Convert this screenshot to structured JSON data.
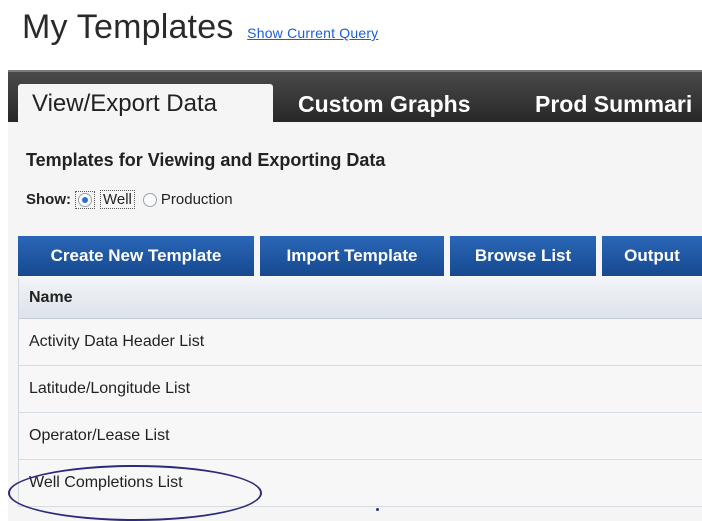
{
  "page": {
    "title": "My Templates",
    "query_link": "Show Current Query"
  },
  "tabs": [
    {
      "label": "View/Export Data",
      "active": true
    },
    {
      "label": "Custom Graphs",
      "active": false
    },
    {
      "label": "Prod Summari",
      "active": false
    }
  ],
  "panel": {
    "heading": "Templates for Viewing and Exporting Data",
    "show_label": "Show:",
    "options": [
      {
        "label": "Well",
        "selected": true
      },
      {
        "label": "Production",
        "selected": false
      }
    ]
  },
  "toolbar": {
    "buttons": [
      "Create New Template",
      "Import Template",
      "Browse List",
      "Output"
    ]
  },
  "table": {
    "header": "Name",
    "rows": [
      "Activity Data Header List",
      "Latitude/Longitude List",
      "Operator/Lease List",
      "Well Completions List"
    ]
  },
  "colors": {
    "tab_bar": "#262626",
    "button": "#1f5aa6",
    "link": "#1a5fd6",
    "highlight_ring": "#2e2a7a"
  }
}
